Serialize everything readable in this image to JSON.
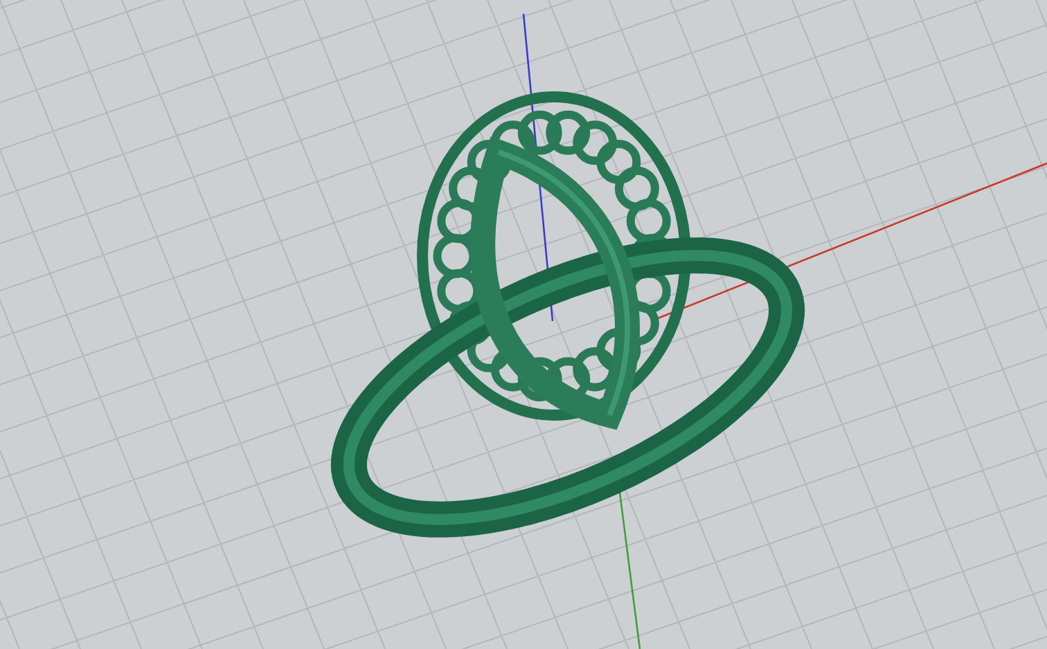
{
  "viewport": {
    "axes": [
      {
        "kind": "x",
        "color": "#c8382e"
      },
      {
        "kind": "y",
        "color": "#3ea03e"
      },
      {
        "kind": "z",
        "color": "#3c3cc8"
      }
    ]
  }
}
